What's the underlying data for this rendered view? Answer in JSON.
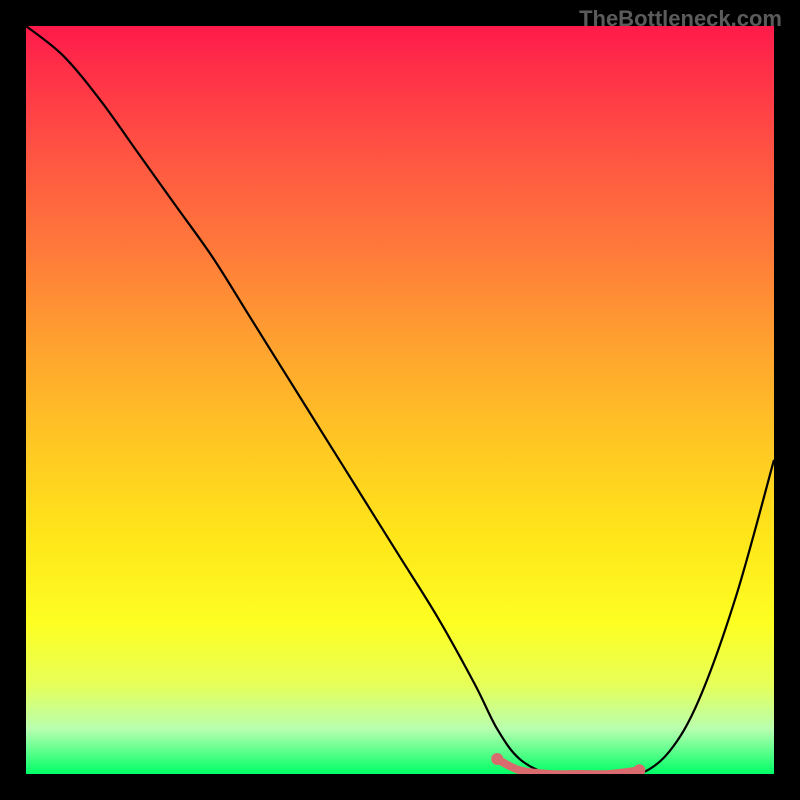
{
  "watermark": "TheBottleneck.com",
  "chart_data": {
    "type": "line",
    "title": "",
    "xlabel": "",
    "ylabel": "",
    "xlim": [
      0,
      100
    ],
    "ylim": [
      0,
      100
    ],
    "grid": false,
    "series": [
      {
        "name": "bottleneck-curve",
        "x": [
          0,
          5,
          10,
          15,
          20,
          25,
          30,
          35,
          40,
          45,
          50,
          55,
          60,
          63,
          66,
          70,
          74,
          78,
          82,
          86,
          90,
          95,
          100
        ],
        "y": [
          100,
          96,
          90,
          83,
          76,
          69,
          61,
          53,
          45,
          37,
          29,
          21,
          12,
          6,
          2,
          0,
          0,
          0,
          0,
          3,
          10,
          24,
          42
        ]
      }
    ],
    "highlight_segment": {
      "name": "optimal-range",
      "x": [
        63,
        66,
        70,
        74,
        78,
        82
      ],
      "y": [
        2,
        0.5,
        0,
        0,
        0,
        0.5
      ],
      "color": "#d96b6f"
    }
  },
  "colors": {
    "curve": "#000000",
    "highlight": "#d96b6f",
    "background_top": "#ff1a4b",
    "background_bottom": "#00ff66"
  }
}
